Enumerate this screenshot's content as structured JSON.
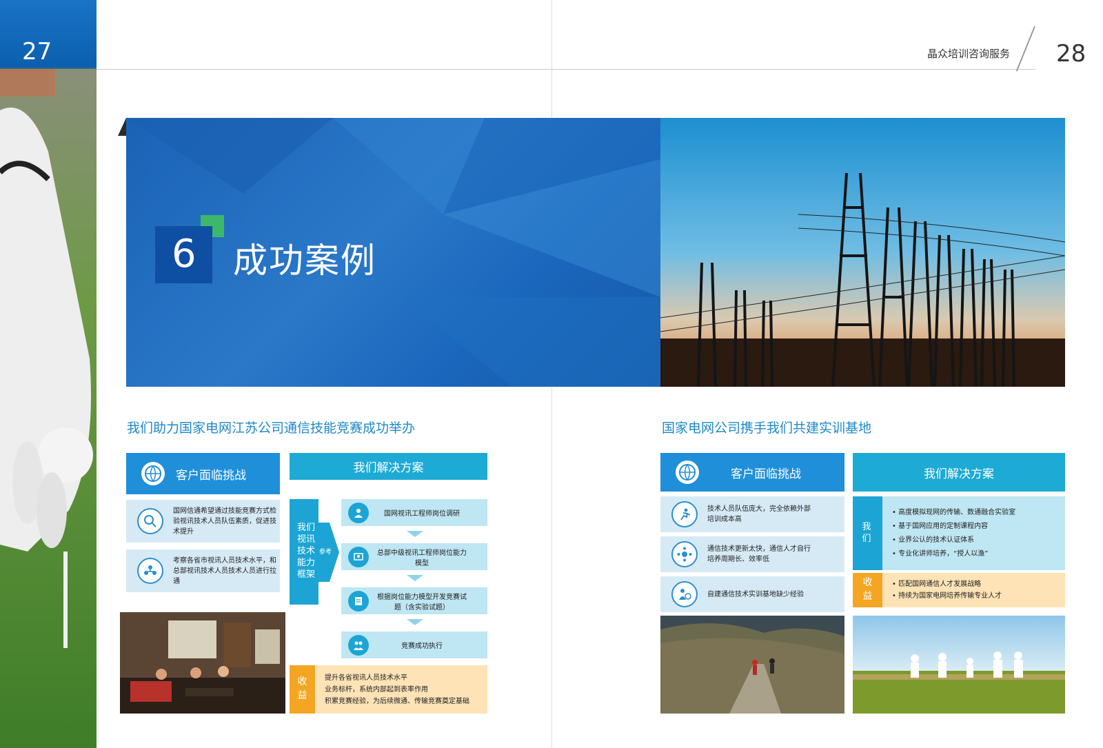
{
  "left_page": {
    "page_number": "27",
    "section": {
      "number": "6",
      "title": "成功案例"
    },
    "case_title": "我们助力国家电网江苏公司通信技能竞赛成功举办",
    "challenge_header": "客户面临挑战",
    "solution_header": "我们解决方案",
    "challenges": [
      {
        "icon": "search-person-icon",
        "text": "国网信通希望通过技能竞赛方式检验视讯技术人员队伍素质，促进技术提升"
      },
      {
        "icon": "team-icon",
        "text": "考察各省市视讯人员技术水平，和总部视讯技术人员技术人员进行拉通"
      }
    ],
    "framework_label": "我们视讯技术能力框架",
    "reference_label": "参考",
    "steps": [
      {
        "icon": "engineer-icon",
        "text": "国网视讯工程师岗位调研"
      },
      {
        "icon": "model-icon",
        "text": "总部中级视讯工程师岗位能力模型"
      },
      {
        "icon": "exam-icon",
        "text": "根据岗位能力模型开发竞赛试题（含实验试题）"
      },
      {
        "icon": "people-icon",
        "text": "竞赛成功执行"
      }
    ],
    "benefit_label": "收益",
    "benefits": [
      "提升各省视讯人员技术水平",
      "业务标杆，系统内部起到表率作用",
      "积累竞赛经验，为后续微通、传输竞赛奠定基础"
    ]
  },
  "right_page": {
    "page_number": "28",
    "company": "晶众培训咨询服务",
    "case_title": "国家电网公司携手我们共建实训基地",
    "challenge_header": "客户面临挑战",
    "solution_header": "我们解决方案",
    "challenges": [
      {
        "icon": "runner-icon",
        "text": "技术人员队伍庞大，完全依赖外部培训成本高"
      },
      {
        "icon": "network-icon",
        "text": "通信技术更新太快，通信人才自行培养周期长、效率低"
      },
      {
        "icon": "clock-person-icon",
        "text": "自建通信技术实训基地缺少经验"
      }
    ],
    "we_label": "我们",
    "solutions": [
      "高度模拟现网的传输、数通融合实验室",
      "基于国网应用的定制课程内容",
      "业界公认的技术认证体系",
      "专业化讲师培养，“授人以渔”"
    ],
    "benefit_label": "收益",
    "benefits": [
      "匹配国网通信人才发展战略",
      "持续为国家电网培养传输专业人才"
    ]
  },
  "colors": {
    "banner_blue": "#1a62b6",
    "header_blue": "#1f8fda",
    "header_cyan": "#1daad5",
    "accent_green": "#3db86a",
    "benefit_orange": "#f4a623",
    "heading_text": "#1e88c9"
  }
}
